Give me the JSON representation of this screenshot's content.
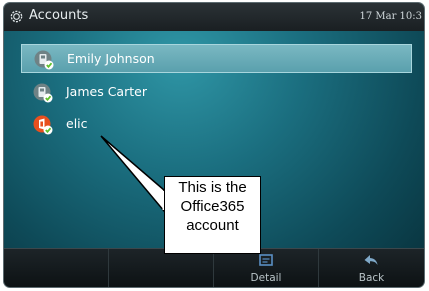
{
  "window": {
    "title": "Accounts",
    "date": "17 Mar 10:3"
  },
  "accounts": [
    {
      "name": "Emily Johnson",
      "icon": "account-status-icon",
      "selected": true
    },
    {
      "name": "James Carter",
      "icon": "account-status-icon",
      "selected": false
    },
    {
      "name": "elic",
      "icon": "office365-icon",
      "selected": false
    }
  ],
  "softkeys": [
    {
      "label": "",
      "icon": ""
    },
    {
      "label": "",
      "icon": ""
    },
    {
      "label": "Detail",
      "icon": "detail-icon"
    },
    {
      "label": "Back",
      "icon": "back-arrow-icon"
    }
  ],
  "callout": {
    "line1": "This is the",
    "line2": "Office365",
    "line3": "account"
  },
  "colors": {
    "selected_row": "#6eaeb9",
    "office_logo": "#e8501e",
    "status_check": "#5fc12b"
  }
}
